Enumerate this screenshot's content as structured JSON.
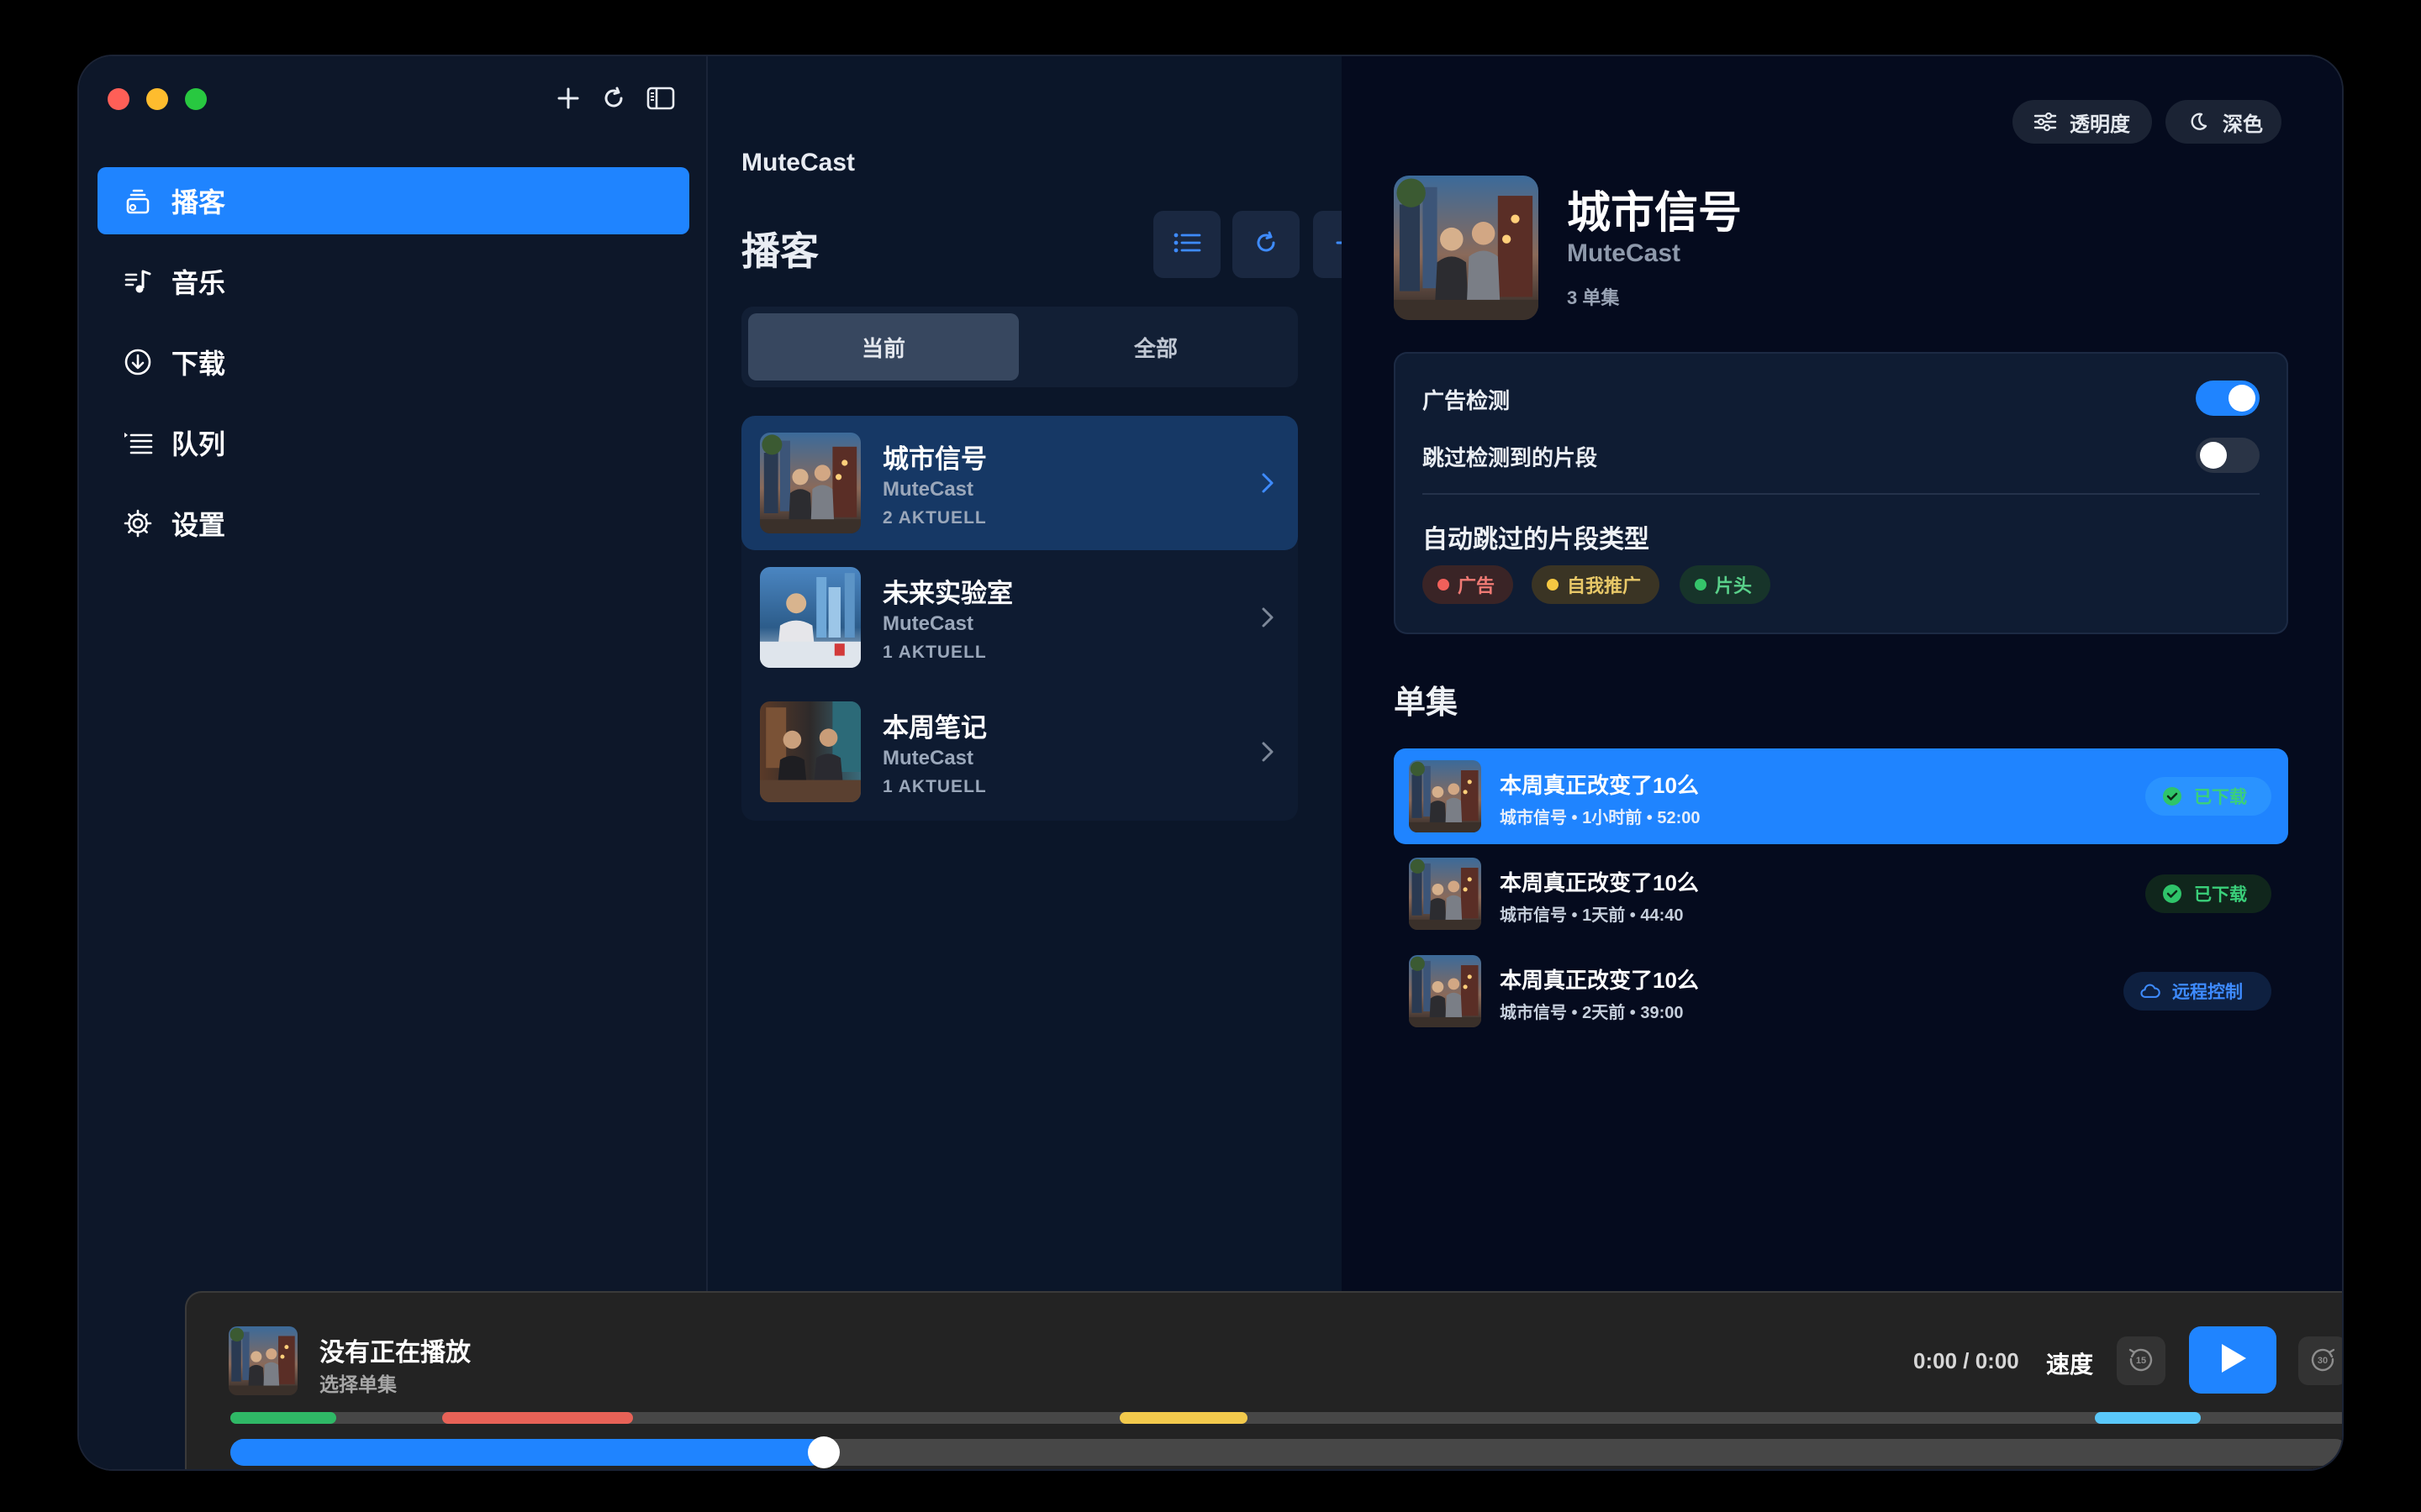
{
  "window": {
    "toolbar_icons": [
      "plus-icon",
      "refresh-icon",
      "sidebar-toggle-icon"
    ]
  },
  "sidebar": {
    "items": [
      {
        "label": "播客",
        "icon": "podcast-icon",
        "active": true
      },
      {
        "label": "音乐",
        "icon": "music-note-list-icon",
        "active": false
      },
      {
        "label": "下载",
        "icon": "download-circle-icon",
        "active": false
      },
      {
        "label": "队列",
        "icon": "queue-list-icon",
        "active": false
      },
      {
        "label": "设置",
        "icon": "gear-icon",
        "active": false
      }
    ]
  },
  "list": {
    "app_name": "MuteCast",
    "title": "播客",
    "segment": {
      "current": "当前",
      "all": "全部",
      "selected": "当前"
    },
    "podcasts": [
      {
        "title": "城市信号",
        "author": "MuteCast",
        "count": "2 AKTUELL",
        "selected": true
      },
      {
        "title": "未来实验室",
        "author": "MuteCast",
        "count": "1 AKTUELL",
        "selected": false
      },
      {
        "title": "本周笔记",
        "author": "MuteCast",
        "count": "1 AKTUELL",
        "selected": false
      }
    ]
  },
  "detail": {
    "opacity_label": "透明度",
    "theme_label": "深色",
    "show_title": "城市信号",
    "show_author": "MuteCast",
    "episode_count": "3 单集",
    "ad_detection_label": "广告检测",
    "ad_detection_on": true,
    "skip_label": "跳过检测到的片段",
    "skip_on": false,
    "auto_skip_heading": "自动跳过的片段类型",
    "tags": [
      {
        "label": "广告",
        "color": "#f0605a"
      },
      {
        "label": "自我推广",
        "color": "#f5c842"
      },
      {
        "label": "片头",
        "color": "#35c46a"
      }
    ],
    "episodes_heading": "单集",
    "episodes": [
      {
        "title": "本周真正改变了10么",
        "meta": "城市信号 • 1小时前 • 52:00",
        "badge": "已下载",
        "badge_type": "downloaded",
        "selected": true
      },
      {
        "title": "本周真正改变了10么",
        "meta": "城市信号 • 1天前 • 44:40",
        "badge": "已下载",
        "badge_type": "downloaded",
        "selected": false
      },
      {
        "title": "本周真正改变了10么",
        "meta": "城市信号 • 2天前 • 39:00",
        "badge": "远程控制",
        "badge_type": "remote",
        "selected": false
      }
    ]
  },
  "player": {
    "title": "没有正在播放",
    "subtitle": "选择单集",
    "time": "0:00 / 0:00",
    "speed_label": "速度",
    "skip_back_label": "15",
    "skip_forward_label": "30",
    "progress_fraction": 0.28,
    "segments": [
      {
        "start": 0.0,
        "end": 0.05,
        "color": "#2fb866"
      },
      {
        "start": 0.1,
        "end": 0.19,
        "color": "#e86257"
      },
      {
        "start": 0.42,
        "end": 0.48,
        "color": "#f2c94c"
      },
      {
        "start": 0.88,
        "end": 0.93,
        "color": "#5ac8fa"
      }
    ]
  }
}
